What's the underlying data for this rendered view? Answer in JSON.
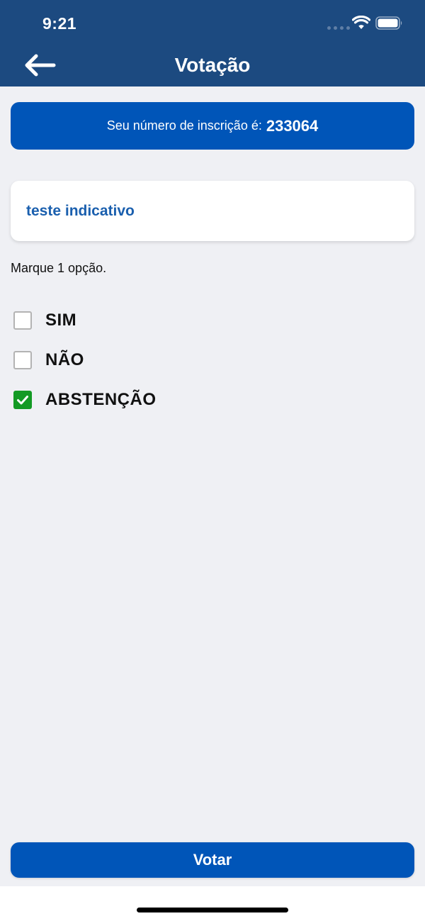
{
  "status_bar": {
    "time": "9:21",
    "icons": [
      "signal-dots-icon",
      "wifi-icon",
      "battery-icon"
    ]
  },
  "header": {
    "title": "Votação",
    "back_icon": "arrow-left-icon"
  },
  "registration": {
    "label": "Seu número de inscrição é:",
    "number": "233064"
  },
  "question": {
    "title": "teste indicativo"
  },
  "instruction": "Marque 1 opção.",
  "options": [
    {
      "label": "SIM",
      "checked": false
    },
    {
      "label": "NÃO",
      "checked": false
    },
    {
      "label": "ABSTENÇÃO",
      "checked": true
    }
  ],
  "vote_button": {
    "label": "Votar"
  },
  "colors": {
    "header_bg": "#1c4a80",
    "primary": "#0055b8",
    "question_text": "#1a5fae",
    "checked": "#139a24",
    "page_bg": "#eff0f4"
  }
}
